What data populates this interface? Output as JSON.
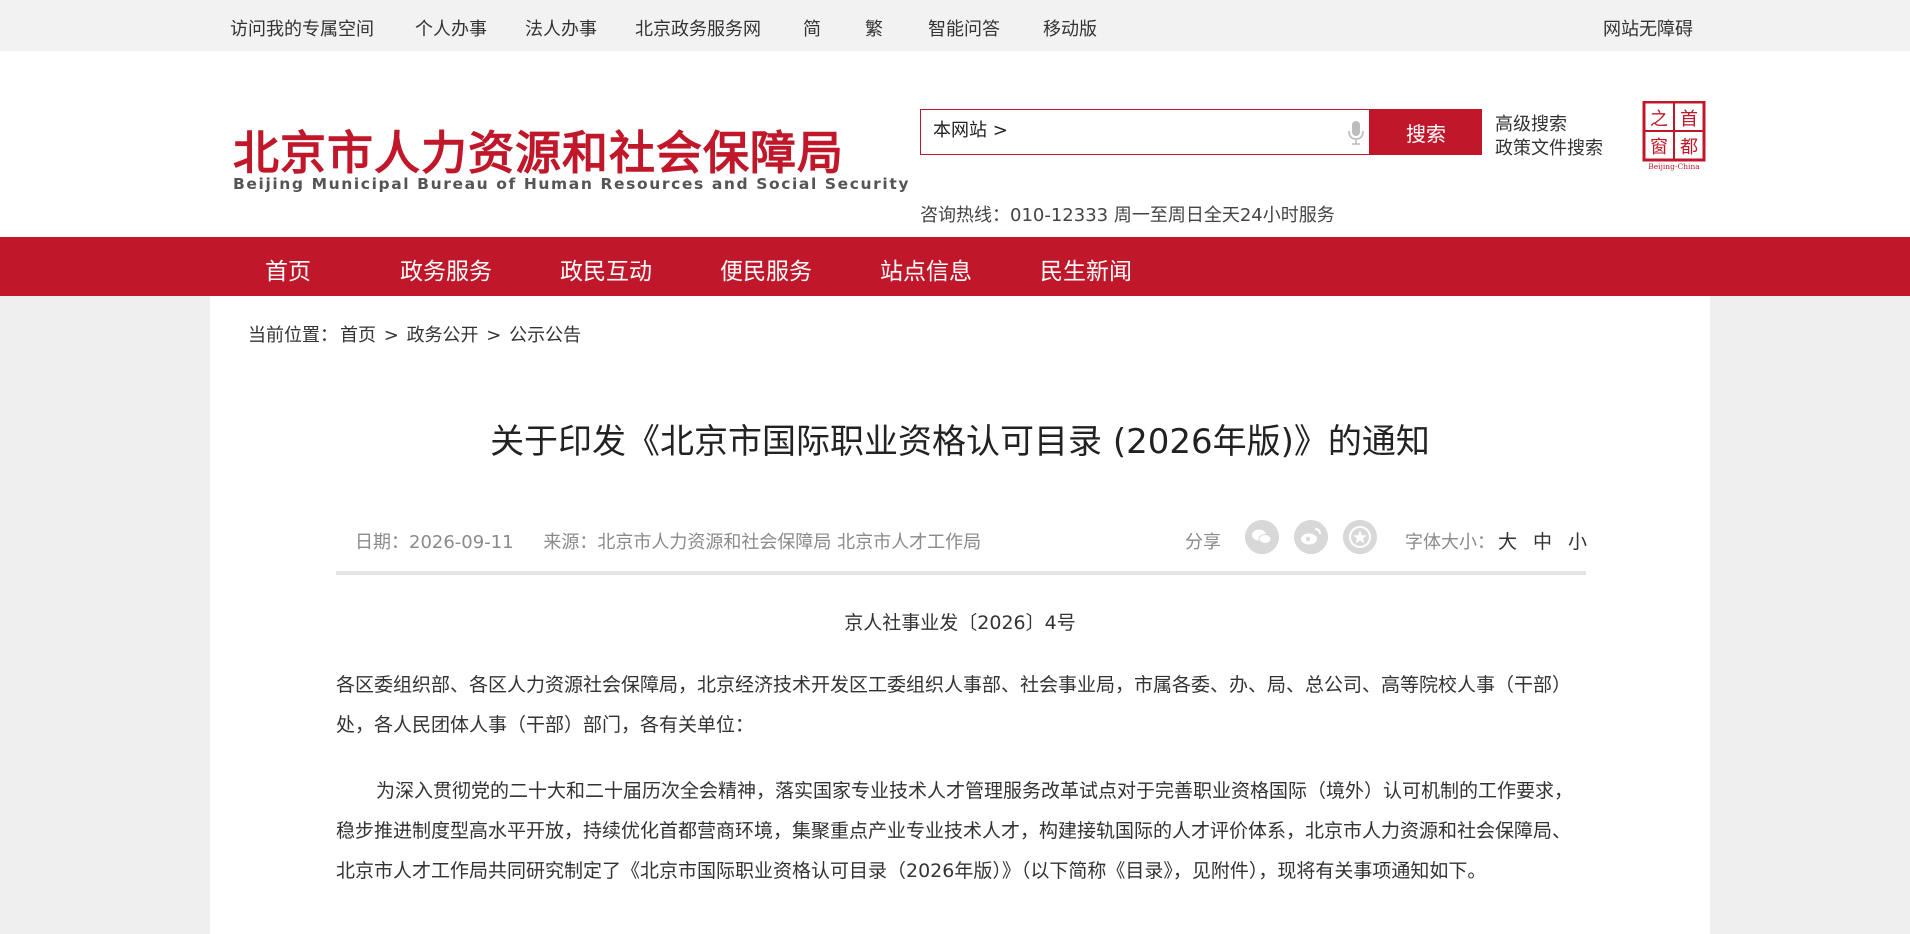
{
  "topbar": {
    "links": [
      "访问我的专属空间",
      "个人办事",
      "法人办事",
      "北京政务服务网",
      "简",
      "繁",
      "智能问答",
      "移动版"
    ],
    "accessibility": "网站无障碍"
  },
  "header": {
    "logo_cn": "北京市人力资源和社会保障局",
    "logo_en": "Beijing Municipal Bureau of Human Resources and Social Security",
    "search_scope": "本网站 >",
    "search_value": "",
    "search_button": "搜索",
    "advanced_search": "高级搜索",
    "policy_search": "政策文件搜索",
    "hotline": "咨询热线：010-12333 周一至周日全天24小时服务",
    "seal": {
      "line1": "首都",
      "line2": "之窗",
      "en": "Beijing-China"
    }
  },
  "nav": [
    "首页",
    "政务服务",
    "政民互动",
    "便民服务",
    "站点信息",
    "民生新闻"
  ],
  "breadcrumb": {
    "label": "当前位置：",
    "items": [
      "首页",
      "政务公开",
      "公示公告"
    ],
    "sep": ">"
  },
  "article": {
    "title": "关于印发《北京市国际职业资格认可目录 (2026年版)》的通知",
    "date_label": "日期：",
    "date": "2026-09-11",
    "source_label": "来源：",
    "source": "北京市人力资源和社会保障局 北京市人才工作局",
    "share_label": "分享",
    "fontsize_label": "字体大小：",
    "fontsize_options": [
      "大",
      "中",
      "小"
    ],
    "doc_number": "京人社事业发〔2026〕4号",
    "addressee": "各区委组织部、各区人力资源社会保障局，北京经济技术开发区工委组织人事部、社会事业局，市属各委、办、局、总公司、高等院校人事（干部）处，各人民团体人事（干部）部门，各有关单位：",
    "paragraph1": "为深入贯彻党的二十大和二十届历次全会精神，落实国家专业技术人才管理服务改革试点对于完善职业资格国际（境外）认可机制的工作要求，稳步推进制度型高水平开放，持续优化首都营商环境，集聚重点产业专业技术人才，构建接轨国际的人才评价体系，北京市人力资源和社会保障局、北京市人才工作局共同研究制定了《北京市国际职业资格认可目录（2026年版）》（以下简称《目录》，见附件），现将有关事项通知如下。"
  },
  "colors": {
    "brand_red": "#c0182a",
    "topbar_bg": "#f2f2f2",
    "page_bg": "#efefef"
  },
  "icons": [
    "microphone-icon",
    "wechat-icon",
    "weibo-icon",
    "favorite-star-icon"
  ]
}
